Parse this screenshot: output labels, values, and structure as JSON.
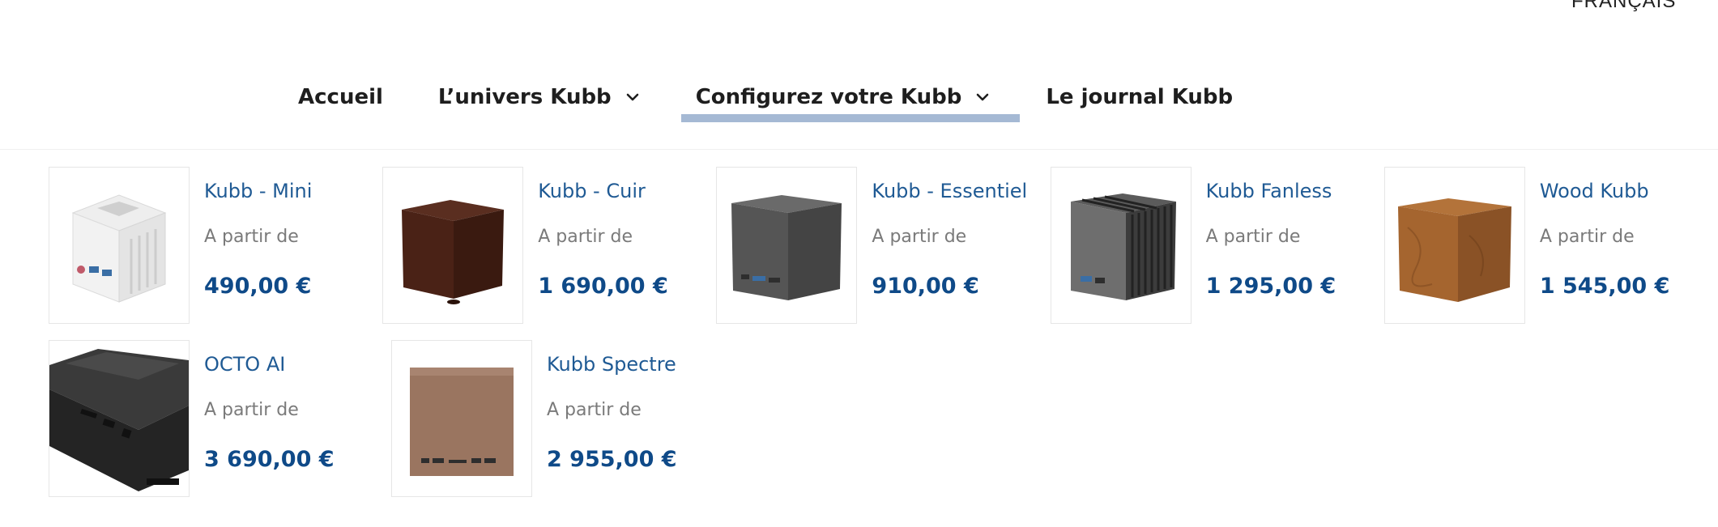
{
  "language": {
    "label": "FRANÇAIS"
  },
  "nav": {
    "items": [
      {
        "label": "Accueil"
      },
      {
        "label": "L’univers Kubb"
      },
      {
        "label": "Configurez votre Kubb"
      },
      {
        "label": "Le journal Kubb"
      }
    ]
  },
  "products": [
    {
      "name": "Kubb - Mini",
      "from": "A partir de",
      "price": "490,00 €",
      "image_icon": "white-mini-cube"
    },
    {
      "name": "Kubb - Cuir",
      "from": "A partir de",
      "price": "1 690,00 €",
      "image_icon": "brown-leather-cube"
    },
    {
      "name": "Kubb - Essentiel",
      "from": "A partir de",
      "price": "910,00 €",
      "image_icon": "dark-grey-cube"
    },
    {
      "name": "Kubb Fanless",
      "from": "A partir de",
      "price": "1 295,00 €",
      "image_icon": "finned-grey-cube"
    },
    {
      "name": "Wood Kubb",
      "from": "A partir de",
      "price": "1 545,00 €",
      "image_icon": "wood-cube"
    },
    {
      "name": "OCTO AI",
      "from": "A partir de",
      "price": "3 690,00 €",
      "image_icon": "black-octo-chassis"
    },
    {
      "name": "Kubb Spectre",
      "from": "A partir de",
      "price": "2 955,00 €",
      "image_icon": "bronze-cube"
    }
  ],
  "colors": {
    "product_name": "#1f5a94",
    "price": "#0f4a88",
    "muted_text": "#7a7a7a",
    "nav_text": "#1e1e1e",
    "active_underline": "#a5b9d4"
  }
}
